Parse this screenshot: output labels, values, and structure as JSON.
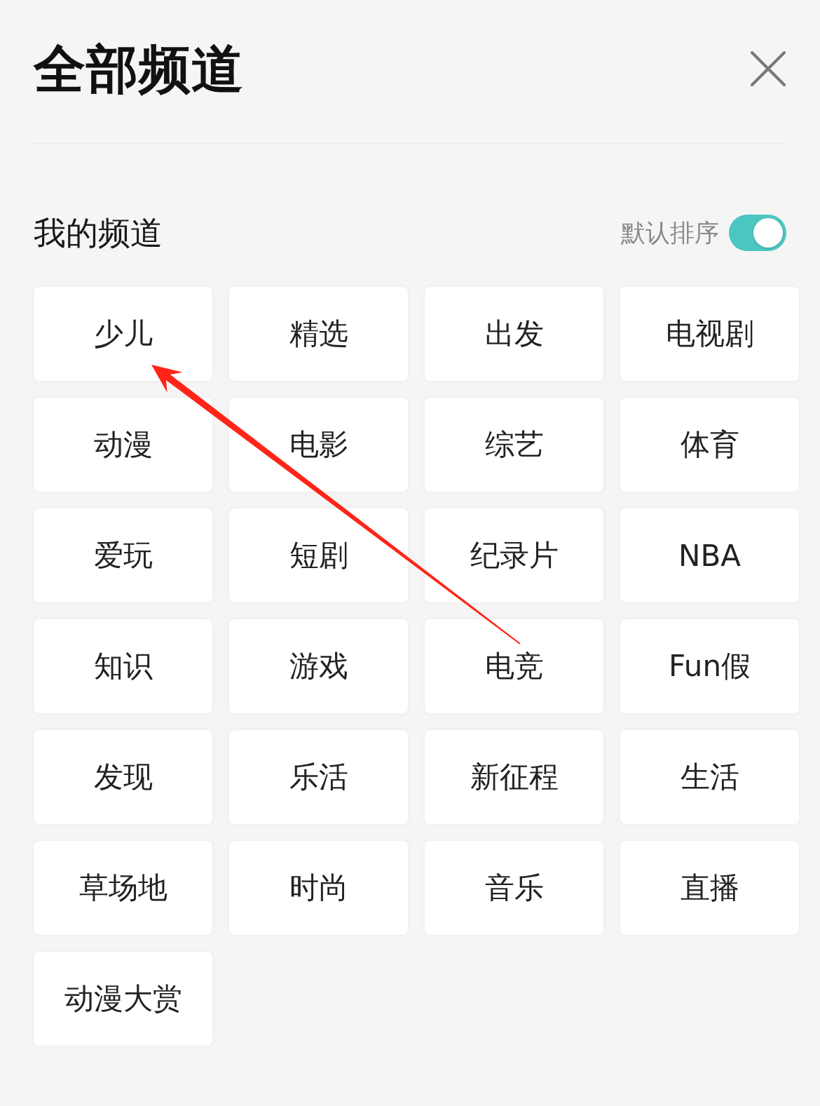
{
  "header": {
    "title": "全部频道"
  },
  "my_channels": {
    "title": "我的频道",
    "sort_toggle": {
      "label": "默认排序",
      "on": true
    },
    "channels": [
      {
        "label": "少儿"
      },
      {
        "label": "精选"
      },
      {
        "label": "出发"
      },
      {
        "label": "电视剧"
      },
      {
        "label": "动漫"
      },
      {
        "label": "电影"
      },
      {
        "label": "综艺"
      },
      {
        "label": "体育"
      },
      {
        "label": "爱玩"
      },
      {
        "label": "短剧"
      },
      {
        "label": "纪录片"
      },
      {
        "label": "NBA"
      },
      {
        "label": "知识"
      },
      {
        "label": "游戏"
      },
      {
        "label": "电竞"
      },
      {
        "label": "Fun假"
      },
      {
        "label": "发现"
      },
      {
        "label": "乐活"
      },
      {
        "label": "新征程"
      },
      {
        "label": "生活"
      },
      {
        "label": "草场地"
      },
      {
        "label": "时尚"
      },
      {
        "label": "音乐"
      },
      {
        "label": "直播"
      },
      {
        "label": "动漫大赏"
      }
    ]
  },
  "annotation": {
    "kind": "arrow"
  }
}
